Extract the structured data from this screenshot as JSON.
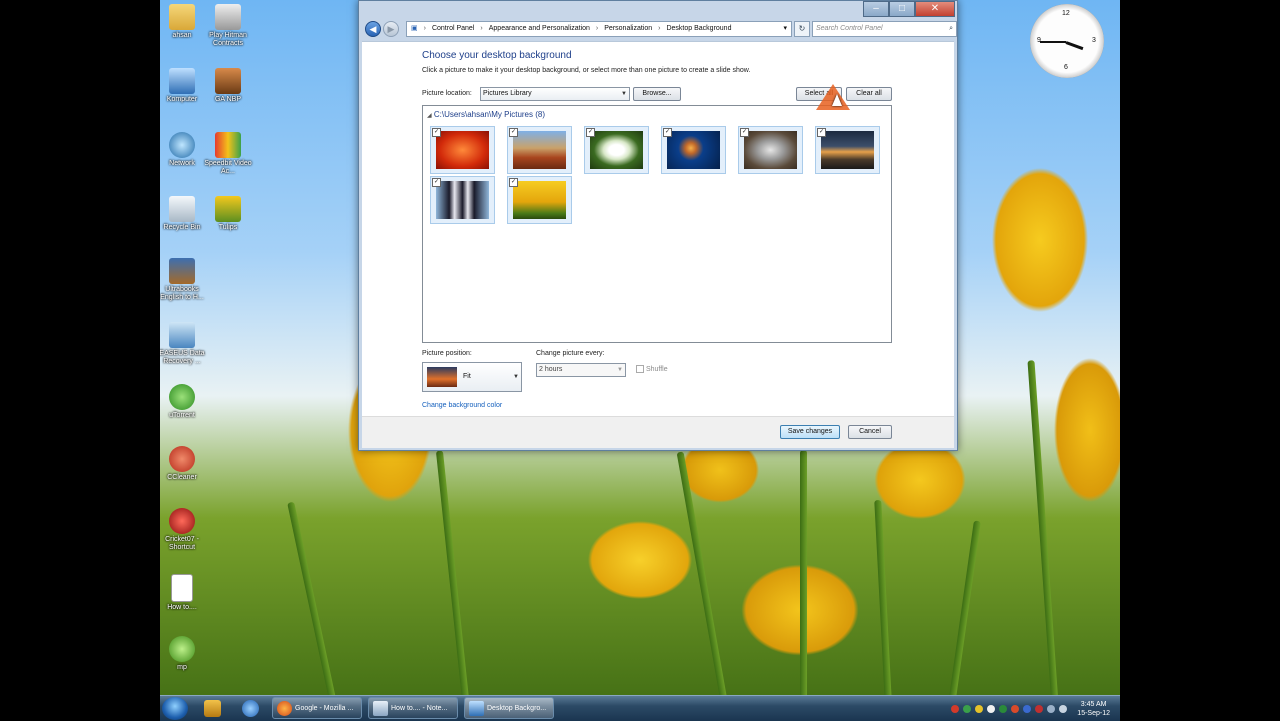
{
  "desktop": {
    "icons": [
      {
        "label": "ahsan"
      },
      {
        "label": "Play Hitman Contracts"
      },
      {
        "label": "Komputer"
      },
      {
        "label": "GA NBP"
      },
      {
        "label": "Network"
      },
      {
        "label": "Speedbit Video Ac..."
      },
      {
        "label": "Recycle Bin"
      },
      {
        "label": "Tulips"
      },
      {
        "label": "Ultrabooks English to H..."
      },
      {
        "label": "EASEUS Data Recovery ..."
      },
      {
        "label": "uTorrent"
      },
      {
        "label": "CCleaner"
      },
      {
        "label": "Cricket07 - Shortcut"
      },
      {
        "label": "How to...."
      },
      {
        "label": "mp"
      }
    ]
  },
  "window": {
    "title_buttons": {
      "minimize": "–",
      "maximize": "□",
      "close": "✕"
    },
    "breadcrumb": [
      "Control Panel",
      "Appearance and Personalization",
      "Personalization",
      "Desktop Background"
    ],
    "search_placeholder": "Search Control Panel",
    "heading": "Choose your desktop background",
    "subheading": "Click a picture to make it your desktop background, or select more than one picture to create a slide show.",
    "picture_location_label": "Picture location:",
    "picture_location_value": "Pictures Library",
    "browse_label": "Browse...",
    "select_all_label": "Select all",
    "clear_all_label": "Clear all",
    "folder_label": "C:\\Users\\ahsan\\My Pictures (8)",
    "pictures": [
      {
        "name": "chrysanthemum",
        "checked": true
      },
      {
        "name": "desert",
        "checked": true
      },
      {
        "name": "hydrangeas",
        "checked": true
      },
      {
        "name": "jellyfish",
        "checked": true
      },
      {
        "name": "koala",
        "checked": true
      },
      {
        "name": "lighthouse",
        "checked": true
      },
      {
        "name": "penguins",
        "checked": true
      },
      {
        "name": "tulips",
        "checked": true
      }
    ],
    "picture_position_label": "Picture position:",
    "picture_position_value": "Fit",
    "change_every_label": "Change picture every:",
    "change_every_value": "2 hours",
    "shuffle_label": "Shuffle",
    "change_bg_color_link": "Change background color",
    "save_label": "Save changes",
    "cancel_label": "Cancel"
  },
  "clock": {
    "numbers": [
      "12",
      "3",
      "6",
      "9"
    ]
  },
  "taskbar": {
    "tasks": [
      {
        "label": "Google - Mozilla ..."
      },
      {
        "label": "How to.... - Note..."
      },
      {
        "label": "Desktop Backgro..."
      }
    ],
    "time": "3:45 AM",
    "date": "15-Sep-12"
  }
}
